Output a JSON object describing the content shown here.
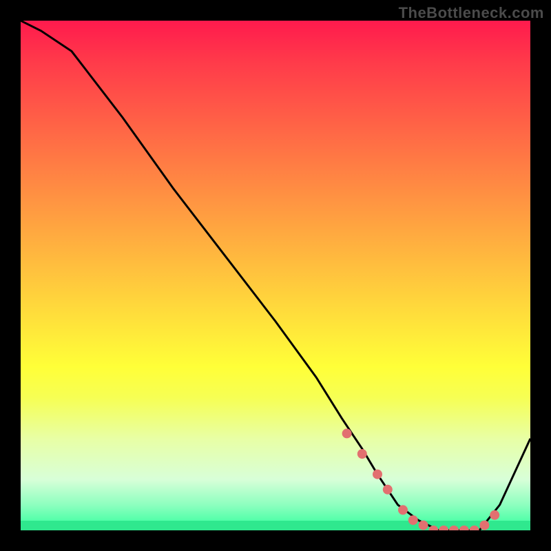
{
  "watermark": "TheBottleneck.com",
  "colors": {
    "background": "#000000",
    "marker": "#e27070",
    "line": "#000000",
    "gradient_top": "#ff1a4d",
    "gradient_bottom": "#2fff9c"
  },
  "chart_data": {
    "type": "line",
    "title": "",
    "xlabel": "",
    "ylabel": "",
    "xlim": [
      0,
      100
    ],
    "ylim": [
      0,
      100
    ],
    "x": [
      0,
      4,
      10,
      20,
      30,
      40,
      50,
      58,
      63,
      67,
      70,
      74,
      78,
      82,
      86,
      90,
      94,
      100
    ],
    "y": [
      100,
      98,
      94,
      81,
      67,
      54,
      41,
      30,
      22,
      16,
      11,
      5,
      2,
      0,
      0,
      0,
      5,
      18
    ],
    "markers": {
      "x": [
        64,
        67,
        70,
        72,
        75,
        77,
        79,
        81,
        83,
        85,
        87,
        89,
        91,
        93
      ],
      "y": [
        19,
        15,
        11,
        8,
        4,
        2,
        1,
        0,
        0,
        0,
        0,
        0,
        1,
        3
      ]
    }
  }
}
